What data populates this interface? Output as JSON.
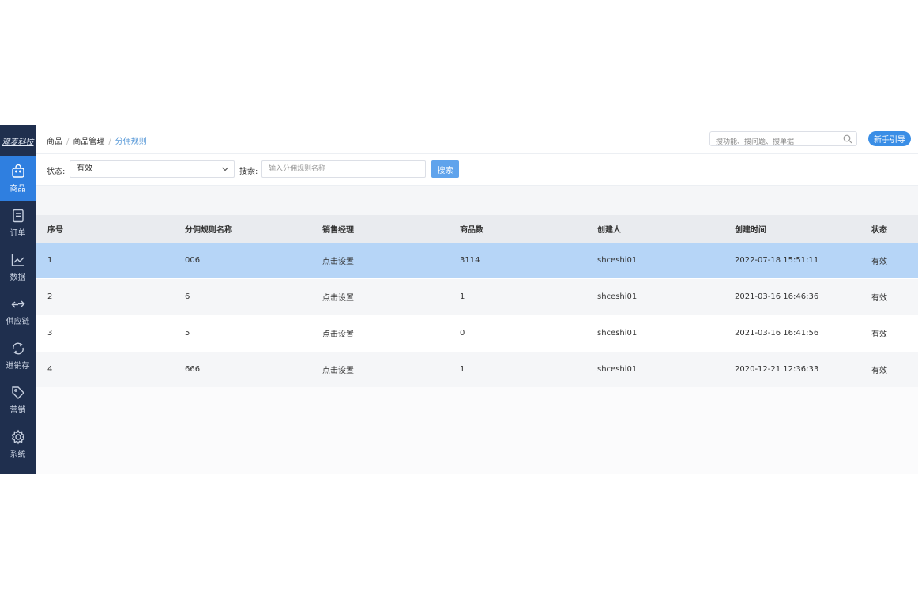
{
  "sidebar": {
    "logo": "观麦科技",
    "items": [
      {
        "key": "goods",
        "label": "商品",
        "icon": "shopping-bag-icon",
        "active": true
      },
      {
        "key": "order",
        "label": "订单",
        "icon": "document-icon"
      },
      {
        "key": "data",
        "label": "数据",
        "icon": "line-chart-icon"
      },
      {
        "key": "supply",
        "label": "供应链",
        "icon": "exchange-arrows-icon"
      },
      {
        "key": "inventory",
        "label": "进销存",
        "icon": "cycle-icon"
      },
      {
        "key": "marketing",
        "label": "营销",
        "icon": "tag-icon"
      },
      {
        "key": "system",
        "label": "系统",
        "icon": "gear-icon"
      }
    ]
  },
  "breadcrumb": [
    "商品",
    "商品管理",
    "分佣规则"
  ],
  "top_search": {
    "placeholder": "搜功能、搜问题、搜单据",
    "icon": "search-icon"
  },
  "guide_button": "新手引导",
  "filter": {
    "status_label": "状态:",
    "status_value": "有效",
    "search_label": "搜索:",
    "search_placeholder": "输入分佣规则名称",
    "search_button": "搜索"
  },
  "table": {
    "headers": [
      "序号",
      "分佣规则名称",
      "销售经理",
      "商品数",
      "创建人",
      "创建时间",
      "状态"
    ],
    "rows": [
      {
        "no": "1",
        "name": "006",
        "manager": "点击设置",
        "count": "3114",
        "creator": "shceshi01",
        "time": "2022-07-18 15:51:11",
        "status": "有效"
      },
      {
        "no": "2",
        "name": "6",
        "manager": "点击设置",
        "count": "1",
        "creator": "shceshi01",
        "time": "2021-03-16 16:46:36",
        "status": "有效"
      },
      {
        "no": "3",
        "name": "5",
        "manager": "点击设置",
        "count": "0",
        "creator": "shceshi01",
        "time": "2021-03-16 16:41:56",
        "status": "有效"
      },
      {
        "no": "4",
        "name": "666",
        "manager": "点击设置",
        "count": "1",
        "creator": "shceshi01",
        "time": "2020-12-21 12:36:33",
        "status": "有效"
      }
    ]
  },
  "colors": {
    "accent": "#3a8ee6",
    "sidebar": "#1f2f4e",
    "selected_row": "#b6d5f7"
  }
}
